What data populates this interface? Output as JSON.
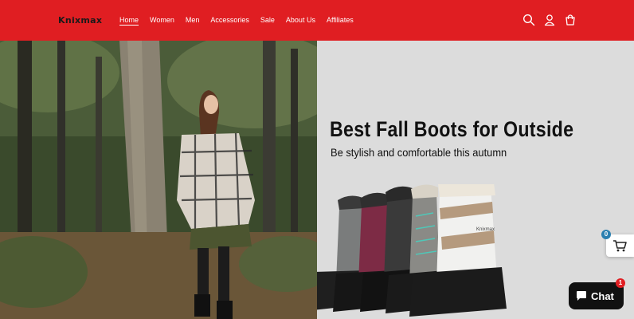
{
  "header": {
    "logo": "Knixmax",
    "nav": [
      {
        "label": "Home"
      },
      {
        "label": "Women"
      },
      {
        "label": "Men"
      },
      {
        "label": "Accessories"
      },
      {
        "label": "Sale"
      },
      {
        "label": "About Us"
      },
      {
        "label": "Affiliates"
      }
    ],
    "icons": [
      "search-icon",
      "account-icon",
      "cart-icon"
    ]
  },
  "hero": {
    "headline": "Best Fall Boots for Outside",
    "subline": "Be stylish and comfortable this autumn",
    "boot_brand": "Knixmax"
  },
  "cart_widget": {
    "count": "0",
    "icon": "shopping-cart-icon"
  },
  "chat_widget": {
    "label": "Chat",
    "badge": "1",
    "icon": "chat-bubble-icon"
  },
  "colors": {
    "header_bg": "#e01e22",
    "panel_bg": "#dcdcdc",
    "cart_badge": "#2a7fb0",
    "chat_bg": "#111111"
  }
}
